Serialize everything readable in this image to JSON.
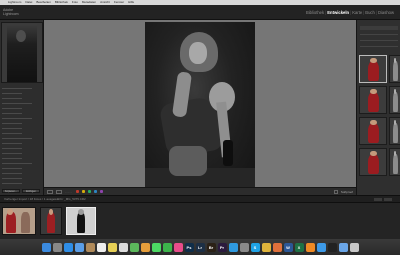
{
  "menubar": {
    "items": [
      "",
      "Lightroom",
      "Datei",
      "Bearbeiten",
      "Bibliothek",
      "Foto",
      "Metadaten",
      "Ansicht",
      "Fenster",
      "Hilfe"
    ]
  },
  "header": {
    "logo_line1": "Adobe",
    "logo_line2": "Lightroom",
    "modules": [
      "Bibliothek",
      "Entwickeln",
      "Karte",
      "Buch",
      "Diashow"
    ],
    "active_module": "Entwickeln"
  },
  "left_panel": {
    "buttons": [
      "Kopieren...",
      "Einfügen"
    ]
  },
  "toolbar": {
    "label": "Softproof"
  },
  "filmstrip": {
    "path": "Vorheriger Import / 18 Fotos / 1 ausgewählt / _MG_5375.CR2"
  },
  "colors": {
    "accent": "#ffffff",
    "label_red": "#c0392b",
    "label_yellow": "#d4ac0d",
    "label_green": "#27ae60",
    "label_blue": "#2e86c1",
    "label_purple": "#8e44ad",
    "dress_red": "#9b1c20"
  },
  "dock": {
    "apps": [
      {
        "name": "finder-icon",
        "text": "",
        "color": "#3b8be0"
      },
      {
        "name": "launchpad-icon",
        "text": "",
        "color": "#888888"
      },
      {
        "name": "safari-icon",
        "text": "",
        "color": "#2e8de6"
      },
      {
        "name": "mail-icon",
        "text": "",
        "color": "#5a9de6"
      },
      {
        "name": "contacts-icon",
        "text": "",
        "color": "#b08a5a"
      },
      {
        "name": "calendar-icon",
        "text": "",
        "color": "#eeeeee"
      },
      {
        "name": "notes-icon",
        "text": "",
        "color": "#e6cf55"
      },
      {
        "name": "reminders-icon",
        "text": "",
        "color": "#dddddd"
      },
      {
        "name": "maps-icon",
        "text": "",
        "color": "#5cb85c"
      },
      {
        "name": "photos-icon",
        "text": "",
        "color": "#e69e3b"
      },
      {
        "name": "messages-icon",
        "text": "",
        "color": "#4cd964"
      },
      {
        "name": "facetime-icon",
        "text": "",
        "color": "#3cb44b"
      },
      {
        "name": "itunes-icon",
        "text": "",
        "color": "#e84c8a"
      },
      {
        "name": "photoshop-icon",
        "text": "Ps",
        "color": "#0f2e4a"
      },
      {
        "name": "lightroom-icon",
        "text": "Lr",
        "color": "#1c2f45"
      },
      {
        "name": "bridge-icon",
        "text": "Br",
        "color": "#2b2116"
      },
      {
        "name": "premiere-icon",
        "text": "Pr",
        "color": "#2b1a3d"
      },
      {
        "name": "appstore-icon",
        "text": "",
        "color": "#2f9ae0"
      },
      {
        "name": "preferences-icon",
        "text": "",
        "color": "#8a8a8a"
      },
      {
        "name": "skype-icon",
        "text": "S",
        "color": "#1fa3e6"
      },
      {
        "name": "chrome-icon",
        "text": "",
        "color": "#e0b43b"
      },
      {
        "name": "firefox-icon",
        "text": "",
        "color": "#e0703b"
      },
      {
        "name": "word-icon",
        "text": "W",
        "color": "#2b5797"
      },
      {
        "name": "excel-icon",
        "text": "X",
        "color": "#1e7145"
      },
      {
        "name": "vlc-icon",
        "text": "",
        "color": "#f08a24"
      },
      {
        "name": "dropbox-icon",
        "text": "",
        "color": "#3d9ae8"
      },
      {
        "name": "terminal-icon",
        "text": "",
        "color": "#222222"
      },
      {
        "name": "downloads-icon",
        "text": "",
        "color": "#6aa6e8"
      },
      {
        "name": "trash-icon",
        "text": "",
        "color": "#c8c8c8"
      }
    ]
  }
}
